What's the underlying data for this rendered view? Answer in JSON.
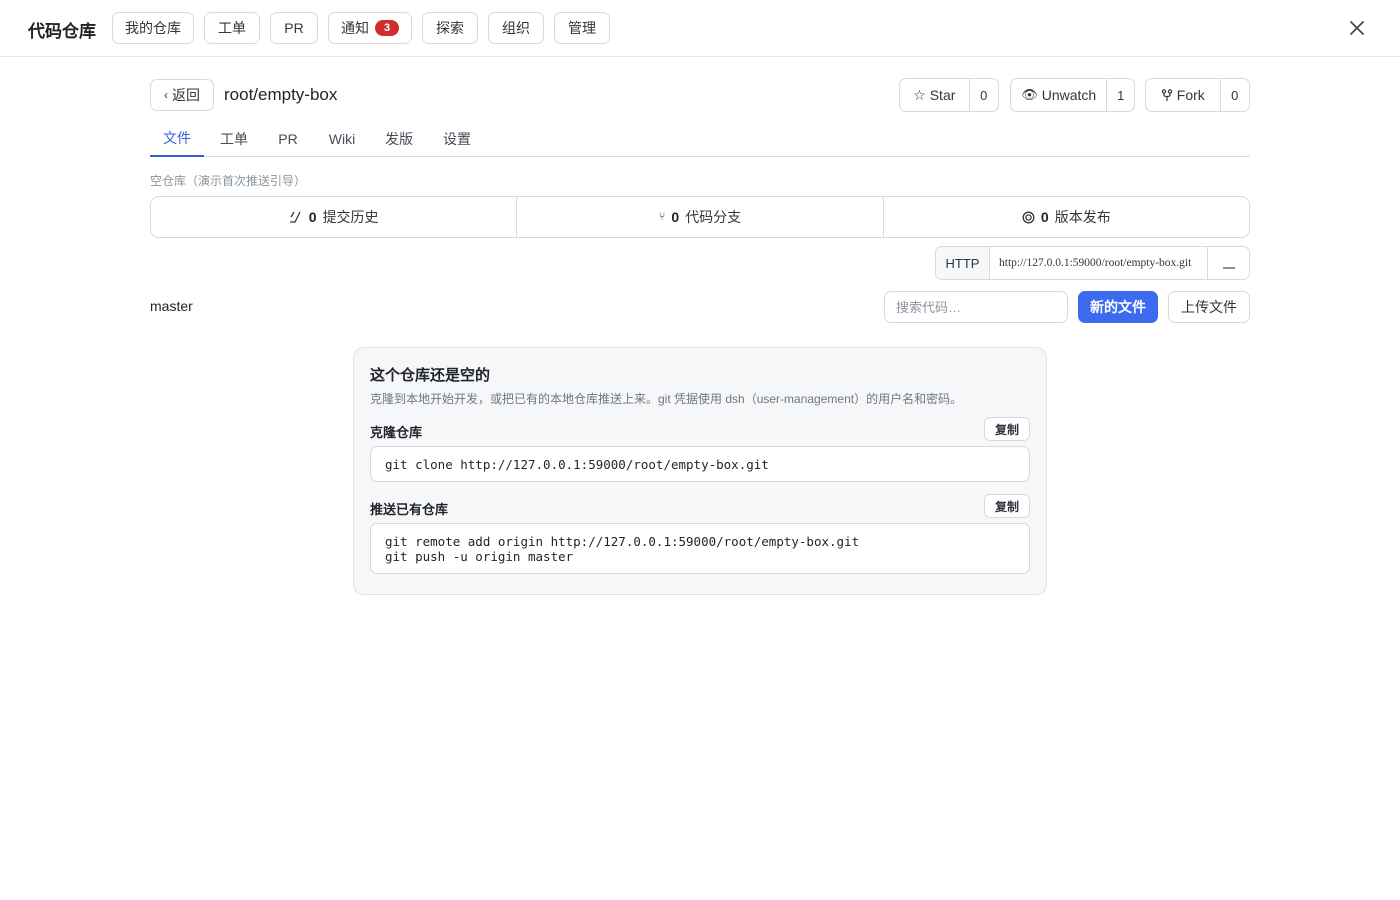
{
  "header": {
    "app_title": "代码仓库",
    "nav": [
      {
        "label": "我的仓库"
      },
      {
        "label": "工单"
      },
      {
        "label": "PR"
      },
      {
        "label": "通知",
        "badge": "3"
      },
      {
        "label": "探索"
      },
      {
        "label": "组织"
      },
      {
        "label": "管理"
      }
    ],
    "close_icon": "close-icon"
  },
  "repo": {
    "back_label": "返回",
    "name": "root/empty-box",
    "star": {
      "label": "Star",
      "count": "0"
    },
    "watch": {
      "label": "Unwatch",
      "count": "1"
    },
    "fork": {
      "label": "Fork",
      "count": "0"
    }
  },
  "tabs": [
    {
      "label": "文件",
      "active": true
    },
    {
      "label": "工单"
    },
    {
      "label": "PR"
    },
    {
      "label": "Wiki"
    },
    {
      "label": "发版"
    },
    {
      "label": "设置"
    }
  ],
  "subtitle": "空仓库（演示首次推送引导）",
  "stats": [
    {
      "icon": "commit-icon",
      "count": "0",
      "label": "提交历史"
    },
    {
      "icon": "branch-icon",
      "count": "0",
      "label": "代码分支"
    },
    {
      "icon": "release-icon",
      "count": "0",
      "label": "版本发布"
    }
  ],
  "clone": {
    "protocol": "HTTP",
    "url": "http://127.0.0.1:59000/root/empty-box.git"
  },
  "toolbar": {
    "branch": "master",
    "search_placeholder": "搜索代码…",
    "new_file": "新的文件",
    "upload": "上传文件"
  },
  "empty": {
    "title": "这个仓库还是空的",
    "desc": "克隆到本地开始开发，或把已有的本地仓库推送上来。git 凭据使用 dsh（user-management）的用户名和密码。",
    "clone_label": "克隆仓库",
    "clone_cmd": "git clone http://127.0.0.1:59000/root/empty-box.git",
    "push_label": "推送已有仓库",
    "push_cmd": "git remote add origin http://127.0.0.1:59000/root/empty-box.git\ngit push -u origin master",
    "copy_label": "复制"
  },
  "colors": {
    "accent": "#3c6bf0",
    "badge": "#cf2e2e"
  }
}
